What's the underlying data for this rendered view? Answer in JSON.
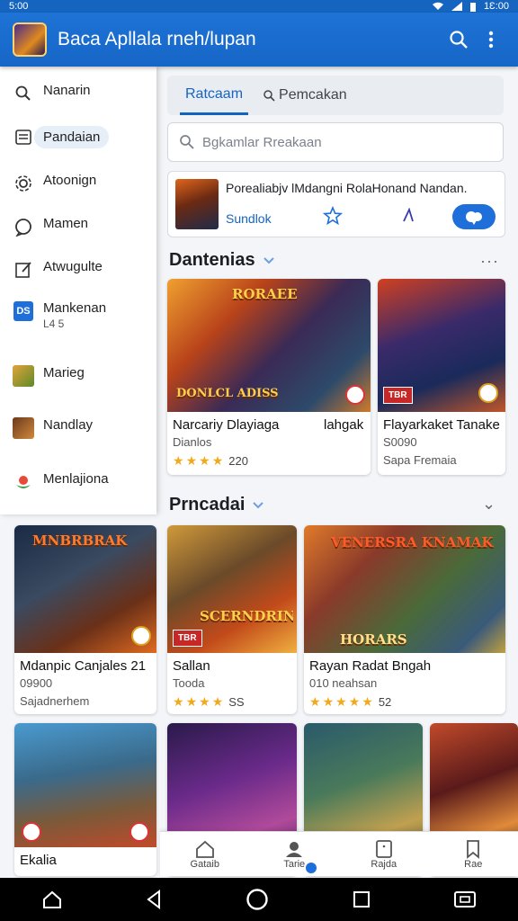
{
  "status_bar": {
    "time": "5:00",
    "clock_right": "1Ɛ:00"
  },
  "app_bar": {
    "title": "Baca Apllala rneh/lupan",
    "icons": [
      "search-icon",
      "more-vert-icon"
    ]
  },
  "drawer": {
    "items": [
      {
        "label": "Nanarin",
        "icon": "search-icon"
      },
      {
        "label": "Pandaian",
        "icon": "list-icon",
        "active": true
      },
      {
        "label": "Atoonign",
        "icon": "settings-icon"
      },
      {
        "label": "Mamen",
        "icon": "chat-icon"
      },
      {
        "label": "Atwugulte",
        "icon": "edit-icon"
      },
      {
        "label": "Mankenan",
        "sub": "L4  5",
        "icon": "badge-icon"
      },
      {
        "label": "Marieg",
        "icon": "game-thumb"
      },
      {
        "label": "Nandlay",
        "icon": "game-thumb"
      },
      {
        "label": "Menlajiona",
        "icon": "flower-icon"
      }
    ]
  },
  "tabs": [
    {
      "label": "Ratcaam",
      "active": true
    },
    {
      "label": "Pemcakan",
      "active": false
    }
  ],
  "search": {
    "placeholder": "Bgkamlar Rreakaan"
  },
  "promo": {
    "text": "Porealiabjv lMdangni RolaHonand Nandan.",
    "sub_label": "Sundlok"
  },
  "sections": [
    {
      "title": "Dantenias",
      "more": "···"
    },
    {
      "title": "Prncadai",
      "more": "⌄"
    }
  ],
  "featured_cards": [
    {
      "art_title": "RORAEE",
      "art_caption": "DONLCL ADISS",
      "name": "Narcariy Dlayiaga",
      "name_right": "lahgak",
      "meta": "Dianlos",
      "rating": "220",
      "stars": 4
    },
    {
      "art_title": "",
      "art_caption": "",
      "name": "Flayarkaket Tanake",
      "name_right": "",
      "meta": "S0090",
      "sub": "Sapa Fremaia",
      "stars": 0
    }
  ],
  "grid_cards": [
    {
      "art_title": "MNBRBRAK",
      "name": "Mdanpic Canjales  21",
      "meta": "09900",
      "sub": "Sajadnerhem",
      "stars": 0
    },
    {
      "art_title": "SCERNDRIN",
      "name": "Sallan",
      "meta": "Tooda",
      "rating": "SS",
      "stars": 4
    },
    {
      "art_title": "HORARS",
      "name": "Rayan Radat Bngah",
      "meta": "010 neahsan",
      "rating": "52",
      "stars": 5
    }
  ],
  "bottom_row": [
    {
      "name": "Ekalia",
      "sub": ""
    },
    {
      "name": "",
      "sub": ""
    },
    {
      "name": "",
      "sub": ""
    },
    {
      "name": "",
      "sub": ""
    }
  ],
  "bottom_nav": [
    {
      "label": "Gataib",
      "icon": "home-icon"
    },
    {
      "label": "Tarie",
      "icon": "person-icon"
    },
    {
      "label": "Rajda",
      "icon": "tablet-icon"
    },
    {
      "label": "Rae",
      "icon": "bookmark-icon"
    }
  ],
  "colors": {
    "accent": "#1565c0",
    "app_bar": "#1e73d6",
    "star": "#f2a91a"
  }
}
